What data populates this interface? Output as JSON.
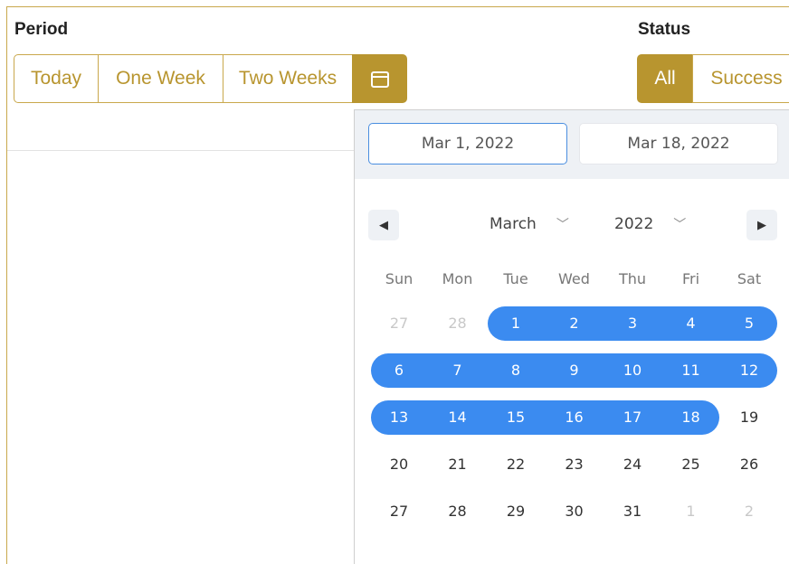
{
  "period": {
    "label": "Period",
    "buttons": [
      "Today",
      "One Week",
      "Two Weeks"
    ],
    "calendar_icon": "calendar-icon"
  },
  "status": {
    "label": "Status",
    "buttons": [
      "All",
      "Success"
    ],
    "active": "All"
  },
  "picker": {
    "start_date": "Mar 1, 2022",
    "end_date": "Mar 18, 2022",
    "month": "March",
    "year": "2022",
    "weekdays": [
      "Sun",
      "Mon",
      "Tue",
      "Wed",
      "Thu",
      "Fri",
      "Sat"
    ],
    "weeks": [
      [
        "27",
        "28",
        "1",
        "2",
        "3",
        "4",
        "5"
      ],
      [
        "6",
        "7",
        "8",
        "9",
        "10",
        "11",
        "12"
      ],
      [
        "13",
        "14",
        "15",
        "16",
        "17",
        "18",
        "19"
      ],
      [
        "20",
        "21",
        "22",
        "23",
        "24",
        "25",
        "26"
      ],
      [
        "27",
        "28",
        "29",
        "30",
        "31",
        "1",
        "2"
      ]
    ],
    "selected_from": "1",
    "selected_to": "18"
  },
  "colors": {
    "accent": "#b8952f",
    "range": "#3b8bf0"
  }
}
